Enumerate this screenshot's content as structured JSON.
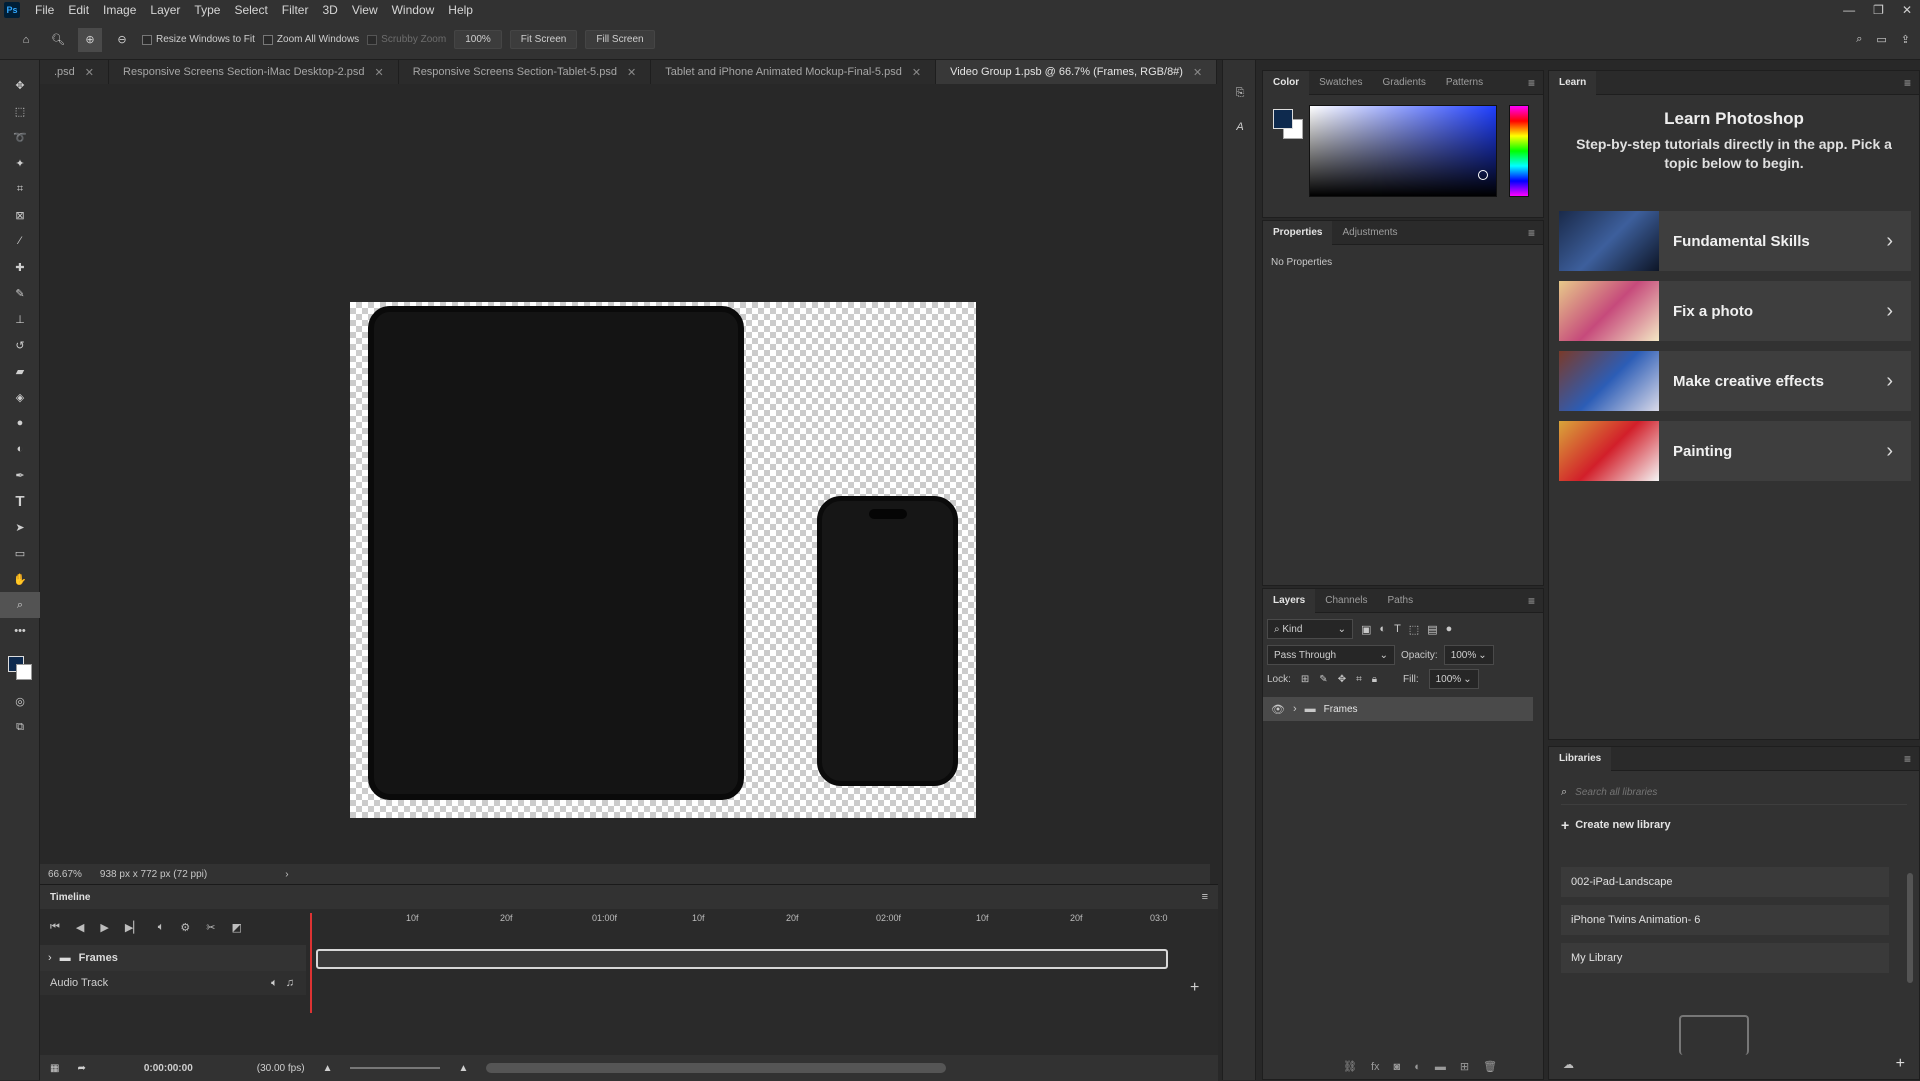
{
  "app": {
    "logo": "Ps"
  },
  "menu": [
    "File",
    "Edit",
    "Image",
    "Layer",
    "Type",
    "Select",
    "Filter",
    "3D",
    "View",
    "Window",
    "Help"
  ],
  "options": {
    "resize_windows": "Resize Windows to Fit",
    "zoom_all": "Zoom All Windows",
    "scrubby": "Scrubby Zoom",
    "zoom_value": "100%",
    "fit_screen": "Fit Screen",
    "fill_screen": "Fill Screen"
  },
  "tabs": [
    {
      "label": ".psd"
    },
    {
      "label": "Responsive Screens Section-iMac Desktop-2.psd"
    },
    {
      "label": "Responsive Screens Section-Tablet-5.psd"
    },
    {
      "label": "Tablet and iPhone Animated Mockup-Final-5.psd"
    },
    {
      "label": "Video Group 1.psb @ 66.7% (Frames, RGB/8#)"
    }
  ],
  "status": {
    "zoom": "66.67%",
    "size": "938 px x 772 px (72 ppi)"
  },
  "timeline": {
    "title": "Timeline",
    "ticks": [
      "10f",
      "20f",
      "01:00f",
      "10f",
      "20f",
      "02:00f",
      "10f",
      "20f",
      "03:0"
    ],
    "frames_label": "Frames",
    "audio_label": "Audio Track",
    "timecode": "0:00:00:00",
    "fps": "(30.00 fps)"
  },
  "color_panel": {
    "tabs": [
      "Color",
      "Swatches",
      "Gradients",
      "Patterns"
    ],
    "fg": "#0e2a4e",
    "bg": "#ffffff"
  },
  "properties_panel": {
    "tabs": [
      "Properties",
      "Adjustments"
    ],
    "empty": "No Properties"
  },
  "layers_panel": {
    "tabs": [
      "Layers",
      "Channels",
      "Paths"
    ],
    "kind": "Kind",
    "blend": "Pass Through",
    "opacity_label": "Opacity:",
    "opacity": "100%",
    "lock_label": "Lock:",
    "fill_label": "Fill:",
    "fill": "100%",
    "layer_name": "Frames"
  },
  "learn": {
    "tab": "Learn",
    "heading": "Learn Photoshop",
    "subtitle": "Step-by-step tutorials directly in the app. Pick a topic below to begin.",
    "cards": [
      {
        "label": "Fundamental Skills"
      },
      {
        "label": "Fix a photo"
      },
      {
        "label": "Make creative effects"
      },
      {
        "label": "Painting"
      }
    ]
  },
  "libraries": {
    "tab": "Libraries",
    "search_placeholder": "Search all libraries",
    "create": "Create new library",
    "items": [
      "002-iPad-Landscape",
      "iPhone Twins Animation- 6",
      "My Library"
    ]
  }
}
